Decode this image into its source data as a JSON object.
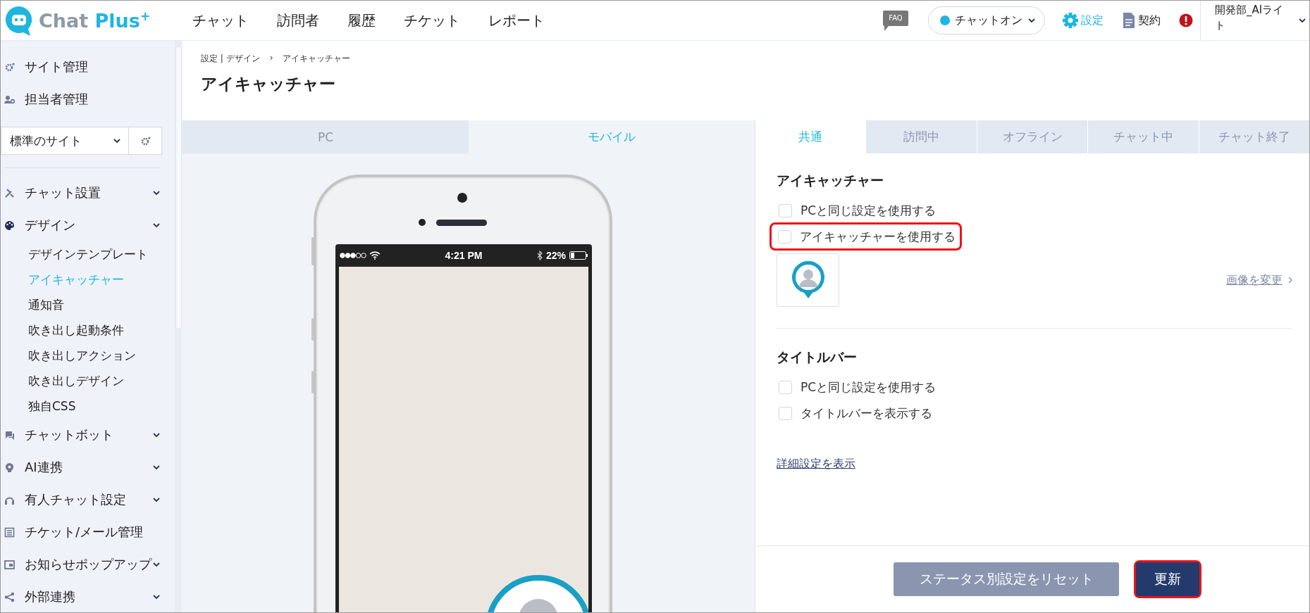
{
  "header": {
    "logo": {
      "word_1": "Chat",
      "word_2": "Plus",
      "mark": "+"
    },
    "nav": [
      {
        "label": "チャット"
      },
      {
        "label": "訪問者"
      },
      {
        "label": "履歴"
      },
      {
        "label": "チケット"
      },
      {
        "label": "レポート"
      }
    ],
    "faq": "FAQ",
    "status": {
      "label": "チャットオン",
      "online": true
    },
    "settings": "設定",
    "contract": "契約",
    "user": "開発部_AIライト"
  },
  "sidebar": {
    "top_items": [
      {
        "label": "サイト管理"
      },
      {
        "label": "担当者管理"
      }
    ],
    "site_select": {
      "value": "標準のサイト"
    },
    "menu": [
      {
        "label": "チャット設置",
        "collapsible": true
      },
      {
        "label": "デザイン",
        "collapsible": true,
        "children": [
          {
            "label": "デザインテンプレート",
            "selected": false
          },
          {
            "label": "アイキャッチャー",
            "selected": true
          },
          {
            "label": "通知音",
            "selected": false
          },
          {
            "label": "吹き出し起動条件",
            "selected": false
          },
          {
            "label": "吹き出しアクション",
            "selected": false
          },
          {
            "label": "吹き出しデザイン",
            "selected": false
          },
          {
            "label": "独自CSS",
            "selected": false
          }
        ]
      },
      {
        "label": "チャットボット",
        "collapsible": true
      },
      {
        "label": "AI連携",
        "collapsible": true
      },
      {
        "label": "有人チャット設定",
        "collapsible": true
      },
      {
        "label": "チケット/メール管理",
        "collapsible": false
      },
      {
        "label": "お知らせポップアップ",
        "collapsible": true
      },
      {
        "label": "外部連携",
        "collapsible": true
      }
    ]
  },
  "main": {
    "breadcrumb": {
      "parent": "設定 | デザイン",
      "separator": "›",
      "current": "アイキャッチャー"
    },
    "title": "アイキャッチャー",
    "preview_tabs": [
      {
        "label": "PC",
        "selected": false
      },
      {
        "label": "モバイル",
        "selected": true
      }
    ],
    "phone": {
      "time": "4:21 PM",
      "battery": "22%"
    },
    "status_tabs": [
      {
        "label": "共通",
        "selected": true
      },
      {
        "label": "訪問中",
        "selected": false
      },
      {
        "label": "オフライン",
        "selected": false
      },
      {
        "label": "チャット中",
        "selected": false
      },
      {
        "label": "チャット終了",
        "selected": false
      }
    ],
    "sections": [
      {
        "title": "アイキャッチャー",
        "options": [
          {
            "label": "PCと同じ設定を使用する",
            "checked": false,
            "highlighted": false
          },
          {
            "label": "アイキャッチャーを使用する",
            "checked": false,
            "highlighted": true
          }
        ],
        "image": {
          "link": "画像を変更"
        }
      },
      {
        "title": "タイトルバー",
        "options": [
          {
            "label": "PCと同じ設定を使用する",
            "checked": false,
            "highlighted": false
          },
          {
            "label": "タイトルバーを表示する",
            "checked": false,
            "highlighted": false
          }
        ]
      }
    ],
    "detail_link": "詳細設定を表示",
    "buttons": [
      {
        "label": "ステータス別設定をリセット",
        "kind": "secondary",
        "highlighted": false
      },
      {
        "label": "更新",
        "kind": "primary",
        "highlighted": true
      }
    ]
  }
}
